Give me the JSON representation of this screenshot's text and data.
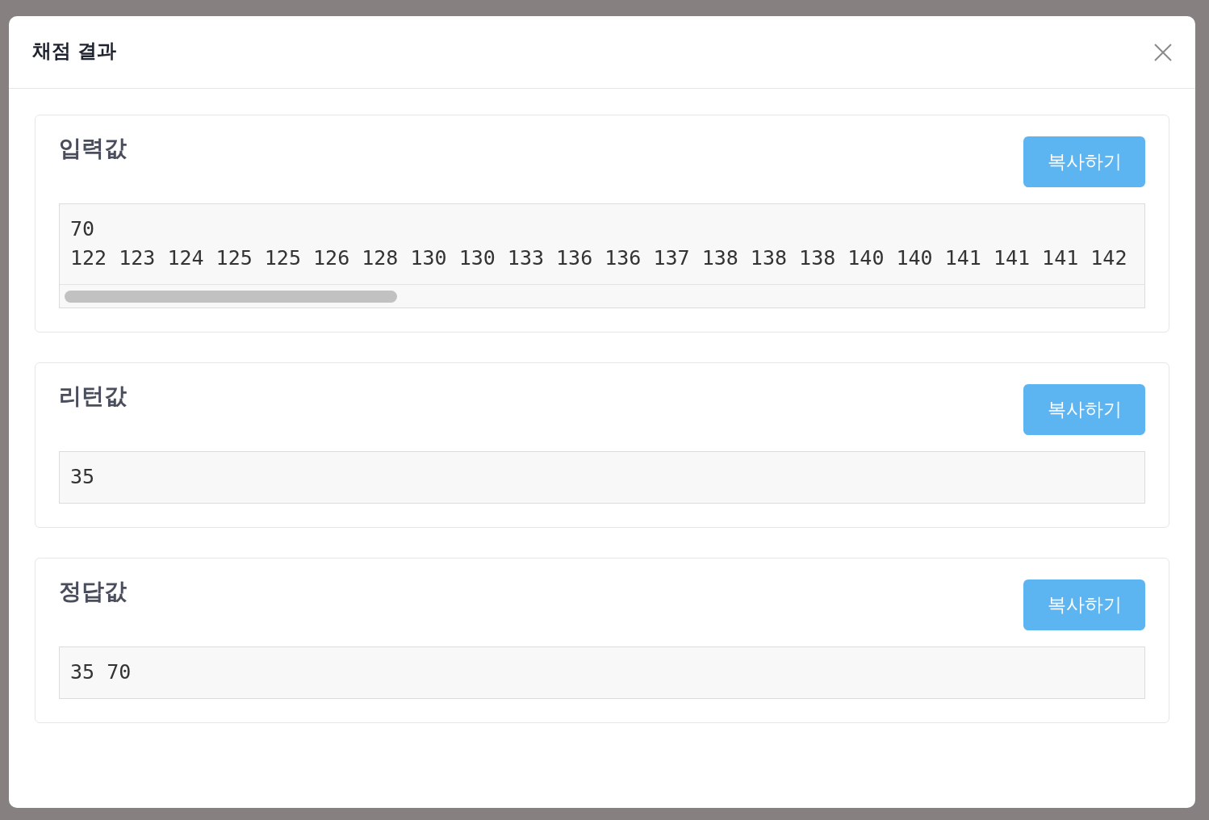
{
  "dialog": {
    "title": "채점 결과",
    "sections": [
      {
        "title": "입력값",
        "copy_button": "복사하기",
        "lines": [
          "70",
          "122 123 124 125 125 126 128 130 130 133 136 136 137 138 138 138 140 140 141 141 141 142"
        ],
        "horizontal_scrollbar": true
      },
      {
        "title": "리턴값",
        "copy_button": "복사하기",
        "lines": [
          "35"
        ],
        "horizontal_scrollbar": false
      },
      {
        "title": "정답값",
        "copy_button": "복사하기",
        "lines": [
          "35 70"
        ],
        "horizontal_scrollbar": false
      }
    ]
  }
}
